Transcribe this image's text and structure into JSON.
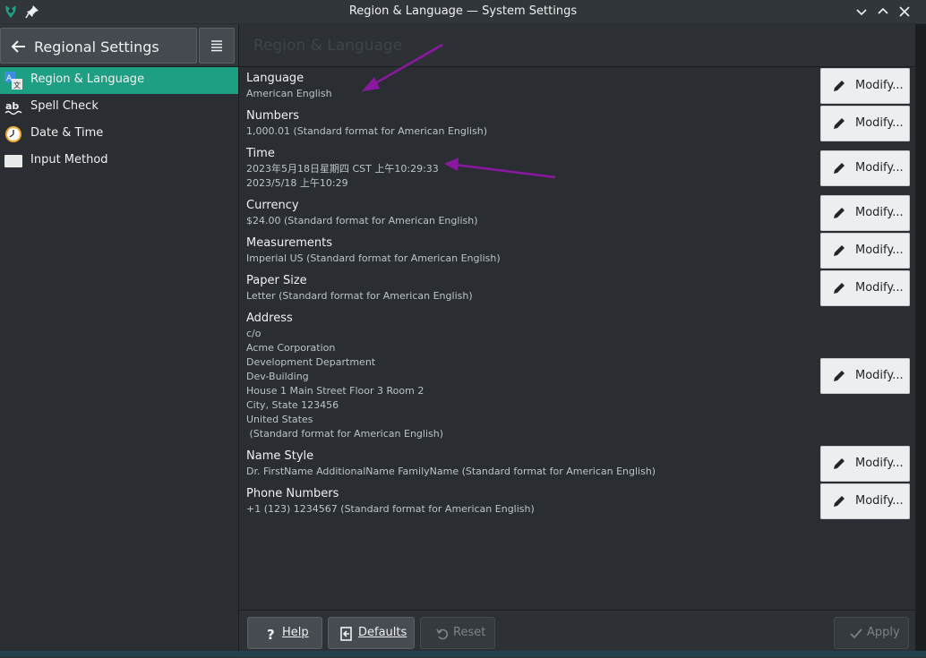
{
  "window": {
    "title": "Region & Language — System Settings",
    "accent": "#1e9e82",
    "annotation_color": "#8b18a0"
  },
  "sidebar": {
    "back_label": "Regional Settings",
    "items": [
      {
        "label": "Region & Language",
        "icon": "translate-icon",
        "active": true
      },
      {
        "label": "Spell Check",
        "icon": "spellcheck-icon",
        "active": false
      },
      {
        "label": "Date & Time",
        "icon": "clock-icon",
        "active": false
      },
      {
        "label": "Input Method",
        "icon": "keyboard-icon",
        "active": false
      }
    ]
  },
  "main": {
    "header_title": "Region & Language",
    "modify_label": "Modify...",
    "rows": [
      {
        "title": "Language",
        "value": "American English"
      },
      {
        "title": "Numbers",
        "value": "1,000.01 (Standard format for American English)"
      },
      {
        "title": "Time",
        "value": "2023年5月18日星期四 CST 上午10:29:33\n2023/5/18 上午10:29"
      },
      {
        "title": "Currency",
        "value": "$24.00 (Standard format for American English)"
      },
      {
        "title": "Measurements",
        "value": "Imperial US (Standard format for American English)"
      },
      {
        "title": "Paper Size",
        "value": "Letter (Standard format for American English)"
      },
      {
        "title": "Address",
        "value": "c/o\nAcme Corporation\nDevelopment Department\nDev-Building\nHouse 1 Main Street Floor 3 Room 2\nCity, State 123456\nUnited States\n (Standard format for American English)"
      },
      {
        "title": "Name Style",
        "value": "Dr. FirstName AdditionalName FamilyName (Standard format for American English)"
      },
      {
        "title": "Phone Numbers",
        "value": "+1 (123) 1234567 (Standard format for American English)"
      }
    ]
  },
  "footer": {
    "help_label": "Help",
    "defaults_label": "Defaults",
    "reset_label": "Reset",
    "apply_label": "Apply"
  }
}
